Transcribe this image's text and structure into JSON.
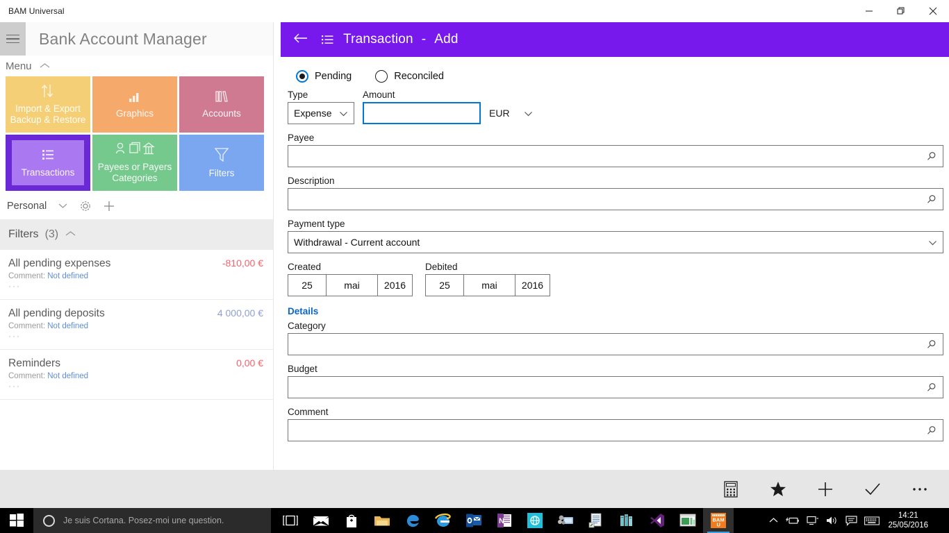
{
  "window": {
    "app_title": "BAM Universal",
    "controls": [
      {
        "name": "minimize",
        "glyph": "—"
      },
      {
        "name": "restore",
        "glyph": "❐"
      },
      {
        "name": "close",
        "glyph": "✕"
      }
    ]
  },
  "sidebar": {
    "hamburger_icon": "hamburger-icon",
    "title": "Bank Account Manager",
    "menu_label": "Menu",
    "menu_chevron": "chevron-up-icon",
    "tiles": [
      {
        "id": "import-export",
        "label": "Import & Export\nBackup & Restore",
        "line1": "Import & Export",
        "line2": "Backup & Restore",
        "color": "#f5cf76",
        "icon": "import-export-icon",
        "selected": false
      },
      {
        "id": "graphics",
        "label": "Graphics",
        "line1": "Graphics",
        "line2": "",
        "color": "#f5a96b",
        "icon": "bar-chart-icon",
        "selected": false
      },
      {
        "id": "accounts",
        "label": "Accounts",
        "line1": "Accounts",
        "line2": "",
        "color": "#cf7a91",
        "icon": "books-icon",
        "selected": false
      },
      {
        "id": "transactions",
        "label": "Transactions",
        "line1": "Transactions",
        "line2": "",
        "color": "#6a28d6",
        "inner_color": "#aa78f0",
        "icon": "list-icon",
        "selected": true
      },
      {
        "id": "payees-categories",
        "label": "Payees or Payers\nCategories",
        "line1": "Payees or Payers",
        "line2": "Categories",
        "color": "#76c98c",
        "icon": "payees-categories-icon",
        "selected": false
      },
      {
        "id": "filters",
        "label": "Filters",
        "line1": "Filters",
        "line2": "",
        "color": "#7aa7f0",
        "icon": "funnel-icon",
        "selected": false
      }
    ],
    "account_row": {
      "name": "Personal",
      "chevron": "chevron-down-icon",
      "settings_icon": "gear-icon",
      "add_icon": "plus-icon"
    },
    "filters_header": {
      "label": "Filters",
      "count": "(3)",
      "chevron": "chevron-up-icon"
    },
    "filters": [
      {
        "name": "All pending expenses",
        "amount": "-810,00 €",
        "tone": "neg",
        "comment_label": "Comment:",
        "comment_value": "Not defined",
        "more": "···"
      },
      {
        "name": "All pending deposits",
        "amount": "4 000,00 €",
        "tone": "pos",
        "comment_label": "Comment:",
        "comment_value": "Not defined",
        "more": "···"
      },
      {
        "name": "Reminders",
        "amount": "0,00 €",
        "tone": "neg",
        "comment_label": "Comment:",
        "comment_value": "Not defined",
        "more": "···"
      }
    ]
  },
  "detail": {
    "header": {
      "back_icon": "back-arrow-icon",
      "page_icon": "transaction-list-icon",
      "title": "Transaction",
      "separator": "-",
      "mode": "Add",
      "accent_color": "#7719ed"
    },
    "status": {
      "options": [
        {
          "label": "Pending",
          "selected": true
        },
        {
          "label": "Reconciled",
          "selected": false
        }
      ]
    },
    "type": {
      "label": "Type",
      "value": "Expense",
      "chevron": "chevron-down-icon"
    },
    "amount": {
      "label": "Amount",
      "value": "",
      "placeholder": "",
      "focused": true
    },
    "currency": {
      "value": "EUR",
      "chevron": "chevron-down-icon"
    },
    "payee": {
      "label": "Payee",
      "value": "",
      "search_icon": "search-icon"
    },
    "description": {
      "label": "Description",
      "value": "",
      "search_icon": "search-icon"
    },
    "payment_type": {
      "label": "Payment type",
      "value": "Withdrawal - Current account",
      "chevron": "chevron-down-icon"
    },
    "created": {
      "label": "Created",
      "day": "25",
      "month": "mai",
      "year": "2016"
    },
    "debited": {
      "label": "Debited",
      "day": "25",
      "month": "mai",
      "year": "2016"
    },
    "details_link": "Details",
    "category": {
      "label": "Category",
      "value": "",
      "search_icon": "search-icon"
    },
    "budget": {
      "label": "Budget",
      "value": "",
      "search_icon": "search-icon"
    },
    "comment": {
      "label": "Comment",
      "value": "",
      "search_icon": "search-icon"
    }
  },
  "commandbar": {
    "buttons": [
      {
        "id": "calculator",
        "icon": "calculator-icon",
        "label": "Calculator"
      },
      {
        "id": "favorite",
        "icon": "star-icon",
        "label": "Favorite"
      },
      {
        "id": "add",
        "icon": "plus-icon",
        "label": "Add"
      },
      {
        "id": "validate",
        "icon": "checkmark-icon",
        "label": "Validate"
      },
      {
        "id": "more",
        "icon": "ellipsis-icon",
        "label": "See more"
      }
    ]
  },
  "taskbar": {
    "start_icon": "windows-start-icon",
    "cortana_placeholder": "Je suis Cortana. Posez-moi une question.",
    "cortana_icon": "cortana-ring-icon",
    "items": [
      {
        "id": "task-view",
        "icon": "task-view-icon",
        "active": false
      },
      {
        "id": "mail",
        "icon": "mail-icon",
        "active": false
      },
      {
        "id": "store",
        "icon": "store-icon",
        "active": false
      },
      {
        "id": "file-explorer",
        "icon": "folder-icon",
        "active": false
      },
      {
        "id": "edge",
        "icon": "edge-icon",
        "active": false
      },
      {
        "id": "internet-explorer",
        "icon": "internet-explorer-icon",
        "active": false
      },
      {
        "id": "outlook",
        "icon": "outlook-icon",
        "active": false
      },
      {
        "id": "onenote",
        "icon": "onenote-icon",
        "active": false
      },
      {
        "id": "app-teal",
        "icon": "teal-app-icon",
        "active": false
      },
      {
        "id": "remote",
        "icon": "remote-desktop-icon",
        "active": false
      },
      {
        "id": "document",
        "icon": "document-shortcut-icon",
        "active": false
      },
      {
        "id": "server",
        "icon": "server-icon",
        "active": false
      },
      {
        "id": "visual-studio",
        "icon": "visual-studio-icon",
        "active": false
      },
      {
        "id": "window-app",
        "icon": "window-app-icon",
        "active": false
      },
      {
        "id": "bam-universal",
        "icon": "bam-universal-icon",
        "label": "BAM U",
        "active": true
      }
    ],
    "tray": [
      {
        "id": "show-hidden",
        "icon": "chevron-up-icon"
      },
      {
        "id": "battery",
        "icon": "battery-icon"
      },
      {
        "id": "network",
        "icon": "network-icon"
      },
      {
        "id": "volume",
        "icon": "speaker-icon"
      },
      {
        "id": "action-center",
        "icon": "action-center-icon"
      },
      {
        "id": "touch-keyboard",
        "icon": "keyboard-icon"
      }
    ],
    "clock": {
      "time": "14:21",
      "date": "25/05/2016"
    }
  }
}
